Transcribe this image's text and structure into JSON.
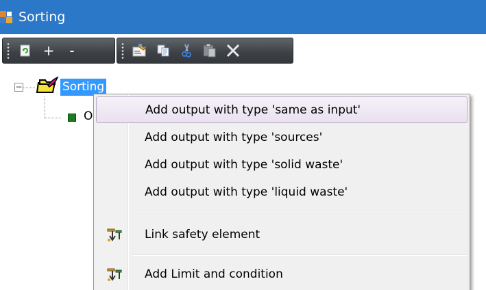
{
  "window": {
    "title": "Sorting"
  },
  "toolbar": {
    "group1": [
      {
        "icon": "refresh-icon"
      },
      {
        "icon": "plus-icon",
        "label": "+"
      },
      {
        "icon": "minus-icon",
        "label": "-"
      }
    ],
    "group2": [
      {
        "icon": "properties-icon"
      },
      {
        "icon": "copy-icon"
      },
      {
        "icon": "cut-icon"
      },
      {
        "icon": "paste-icon"
      },
      {
        "icon": "delete-icon"
      }
    ]
  },
  "tree": {
    "root": {
      "label": "Sorting",
      "expander": "−",
      "icon": "folder-node-icon"
    },
    "child": {
      "label": "O",
      "icon": "green-square-icon"
    }
  },
  "context_menu": {
    "items": [
      {
        "label": "Add output with type 'same as input'",
        "highlighted": true
      },
      {
        "label": "Add output with type 'sources'"
      },
      {
        "label": "Add output with type 'solid waste'"
      },
      {
        "label": "Add output with type 'liquid waste'"
      },
      {
        "label": "Link safety element",
        "icon": "link-element-icon"
      },
      {
        "label": "Add Limit and condition",
        "icon": "add-limit-icon"
      }
    ]
  }
}
